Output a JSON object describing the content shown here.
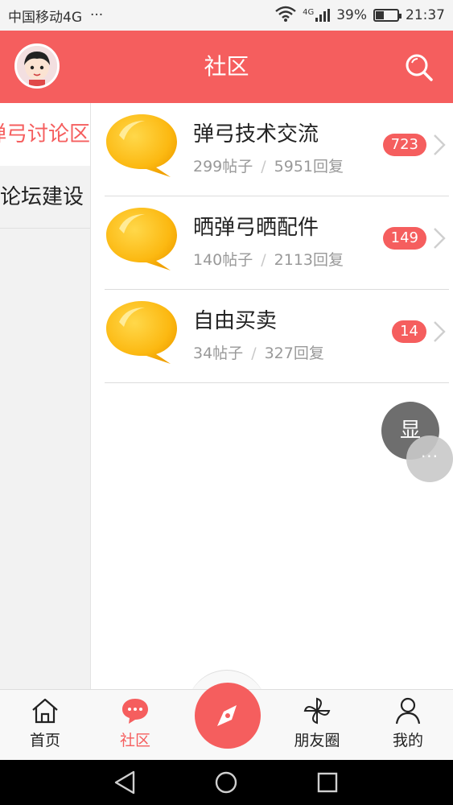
{
  "status_bar": {
    "carrier": "中国移动4G",
    "dots": "···",
    "network": "4G",
    "battery_percent": "39%",
    "time": "21:37",
    "battery_level": 0.39
  },
  "header": {
    "title": "社区"
  },
  "sidebar": {
    "categories": [
      {
        "label": "弹弓讨论区"
      },
      {
        "label": "论坛建设"
      }
    ]
  },
  "forums": [
    {
      "name": "弹弓技术交流",
      "posts": "299帖子",
      "sep": "/",
      "replies": "5951回复",
      "badge": "723"
    },
    {
      "name": "晒弹弓晒配件",
      "posts": "140帖子",
      "sep": "/",
      "replies": "2113回复",
      "badge": "149"
    },
    {
      "name": "自由买卖",
      "posts": "34帖子",
      "sep": "/",
      "replies": "327回复",
      "badge": "14"
    }
  ],
  "floating": {
    "show_label": "显",
    "more_label": "···"
  },
  "tabbar": {
    "tabs": [
      {
        "label": "首页",
        "icon": "home-icon"
      },
      {
        "label": "社区",
        "icon": "chat-bubble-icon"
      },
      {
        "label": "",
        "icon": "compass-icon"
      },
      {
        "label": "朋友圈",
        "icon": "pinwheel-icon"
      },
      {
        "label": "我的",
        "icon": "person-icon"
      }
    ]
  },
  "colors": {
    "accent": "#f55e5e",
    "bubble": "#fdc21b"
  }
}
